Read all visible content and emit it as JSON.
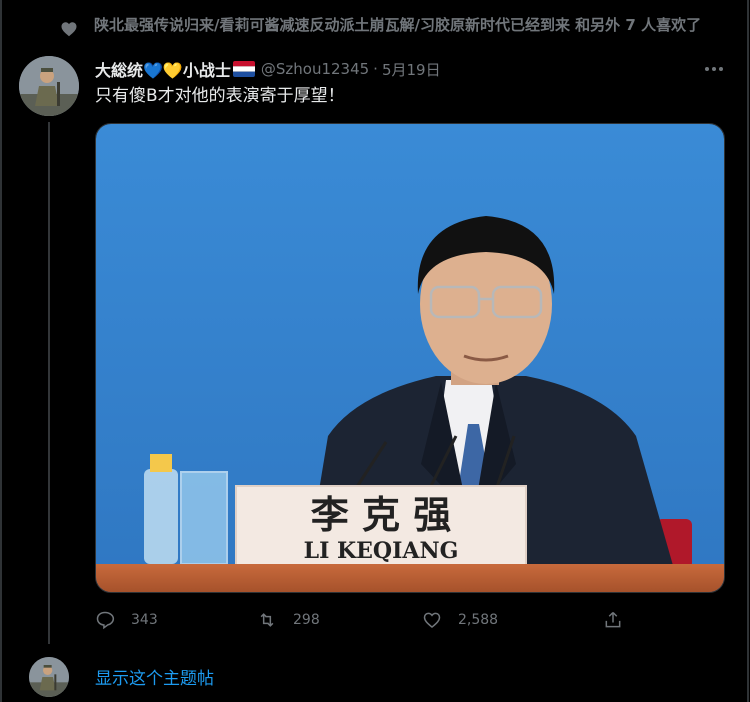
{
  "social_context": {
    "text": "陕北最强传说归来/看莉可酱减速反动派土崩瓦解/习胶原新时代已经到来 和另外 7 人喜欢了",
    "icon": "heart-icon"
  },
  "tweet": {
    "display_name": "大総统💙💛小战士",
    "flag_icon": "netherlands-flag-icon",
    "handle": "@Szhou12345",
    "separator": "·",
    "date": "5月19日",
    "text": "只有傻B才对他的表演寄于厚望！",
    "media": {
      "nameplate_chinese": "李 克 强",
      "nameplate_english": "LI KEQIANG",
      "background_color": "#3d8bd4"
    },
    "actions": {
      "reply_count": "343",
      "retweet_count": "298",
      "like_count": "2,588"
    }
  },
  "show_thread": {
    "label": "显示这个主题帖"
  },
  "colors": {
    "background": "#000000",
    "text_primary": "#e7e9ea",
    "text_secondary": "#71767b",
    "link": "#1d9bf0"
  }
}
